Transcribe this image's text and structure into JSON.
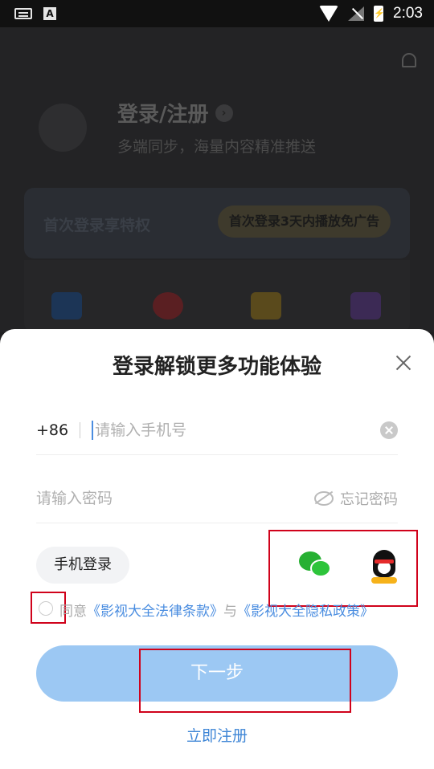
{
  "status_bar": {
    "time": "2:03",
    "battery_glyph": "⚡",
    "a_icon": "A"
  },
  "background_page": {
    "title": "登录/注册",
    "subtitle": "多端同步，海量内容精准推送",
    "vip_text": "首次登录享特权",
    "vip_button": "首次登录3天内播放免广告",
    "quick_icons": [
      "download-icon",
      "heart-icon",
      "star-icon",
      "history-icon"
    ]
  },
  "modal": {
    "title": "登录解锁更多功能体验",
    "country_code": "+86",
    "phone_placeholder": "请输入手机号",
    "password_placeholder": "请输入密码",
    "forgot_password": "忘记密码",
    "phone_login": "手机登录",
    "agree_prefix": "同意",
    "legal_terms": "《影视大全法律条款》",
    "and": "与",
    "privacy_policy": "《影视大全隐私政策》",
    "next_button": "下一步",
    "register_now": "立即注册"
  },
  "colors": {
    "accent": "#4a8de0",
    "button_bg": "#9cc8f3",
    "highlight_box": "#d0021b"
  }
}
